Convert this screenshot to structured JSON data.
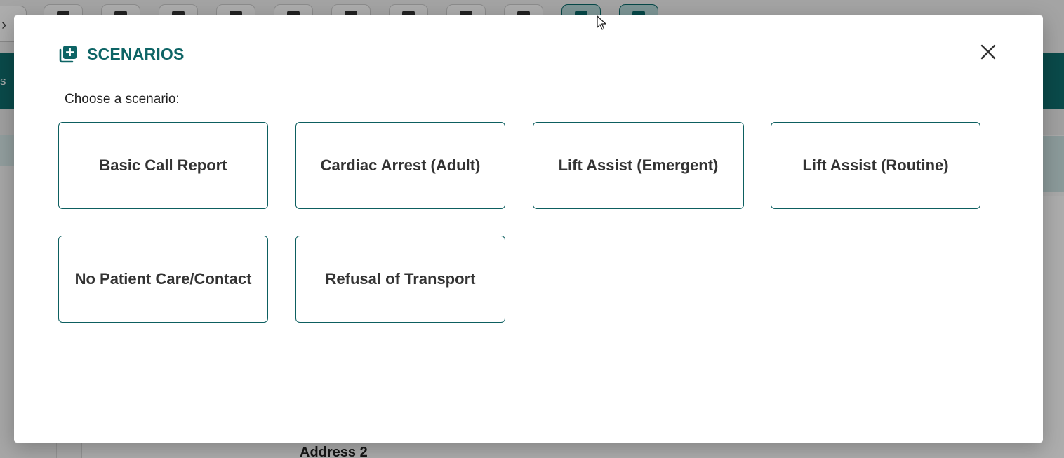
{
  "background": {
    "left_chevron": "›",
    "band_text": "s",
    "address_label": "Address 2"
  },
  "modal": {
    "title": "SCENARIOS",
    "title_icon": "add-to-library-icon",
    "close_icon": "close-icon",
    "prompt": "Choose a scenario:",
    "scenarios": [
      {
        "label": "Basic Call Report"
      },
      {
        "label": "Cardiac Arrest (Adult)"
      },
      {
        "label": "Lift Assist (Emergent)"
      },
      {
        "label": "Lift Assist (Routine)"
      },
      {
        "label": "No Patient Care/Contact"
      },
      {
        "label": "Refusal of Transport"
      }
    ]
  },
  "colors": {
    "accent": "#0d6465",
    "card_border": "#0d5f60",
    "band": "#0f6e6e"
  }
}
